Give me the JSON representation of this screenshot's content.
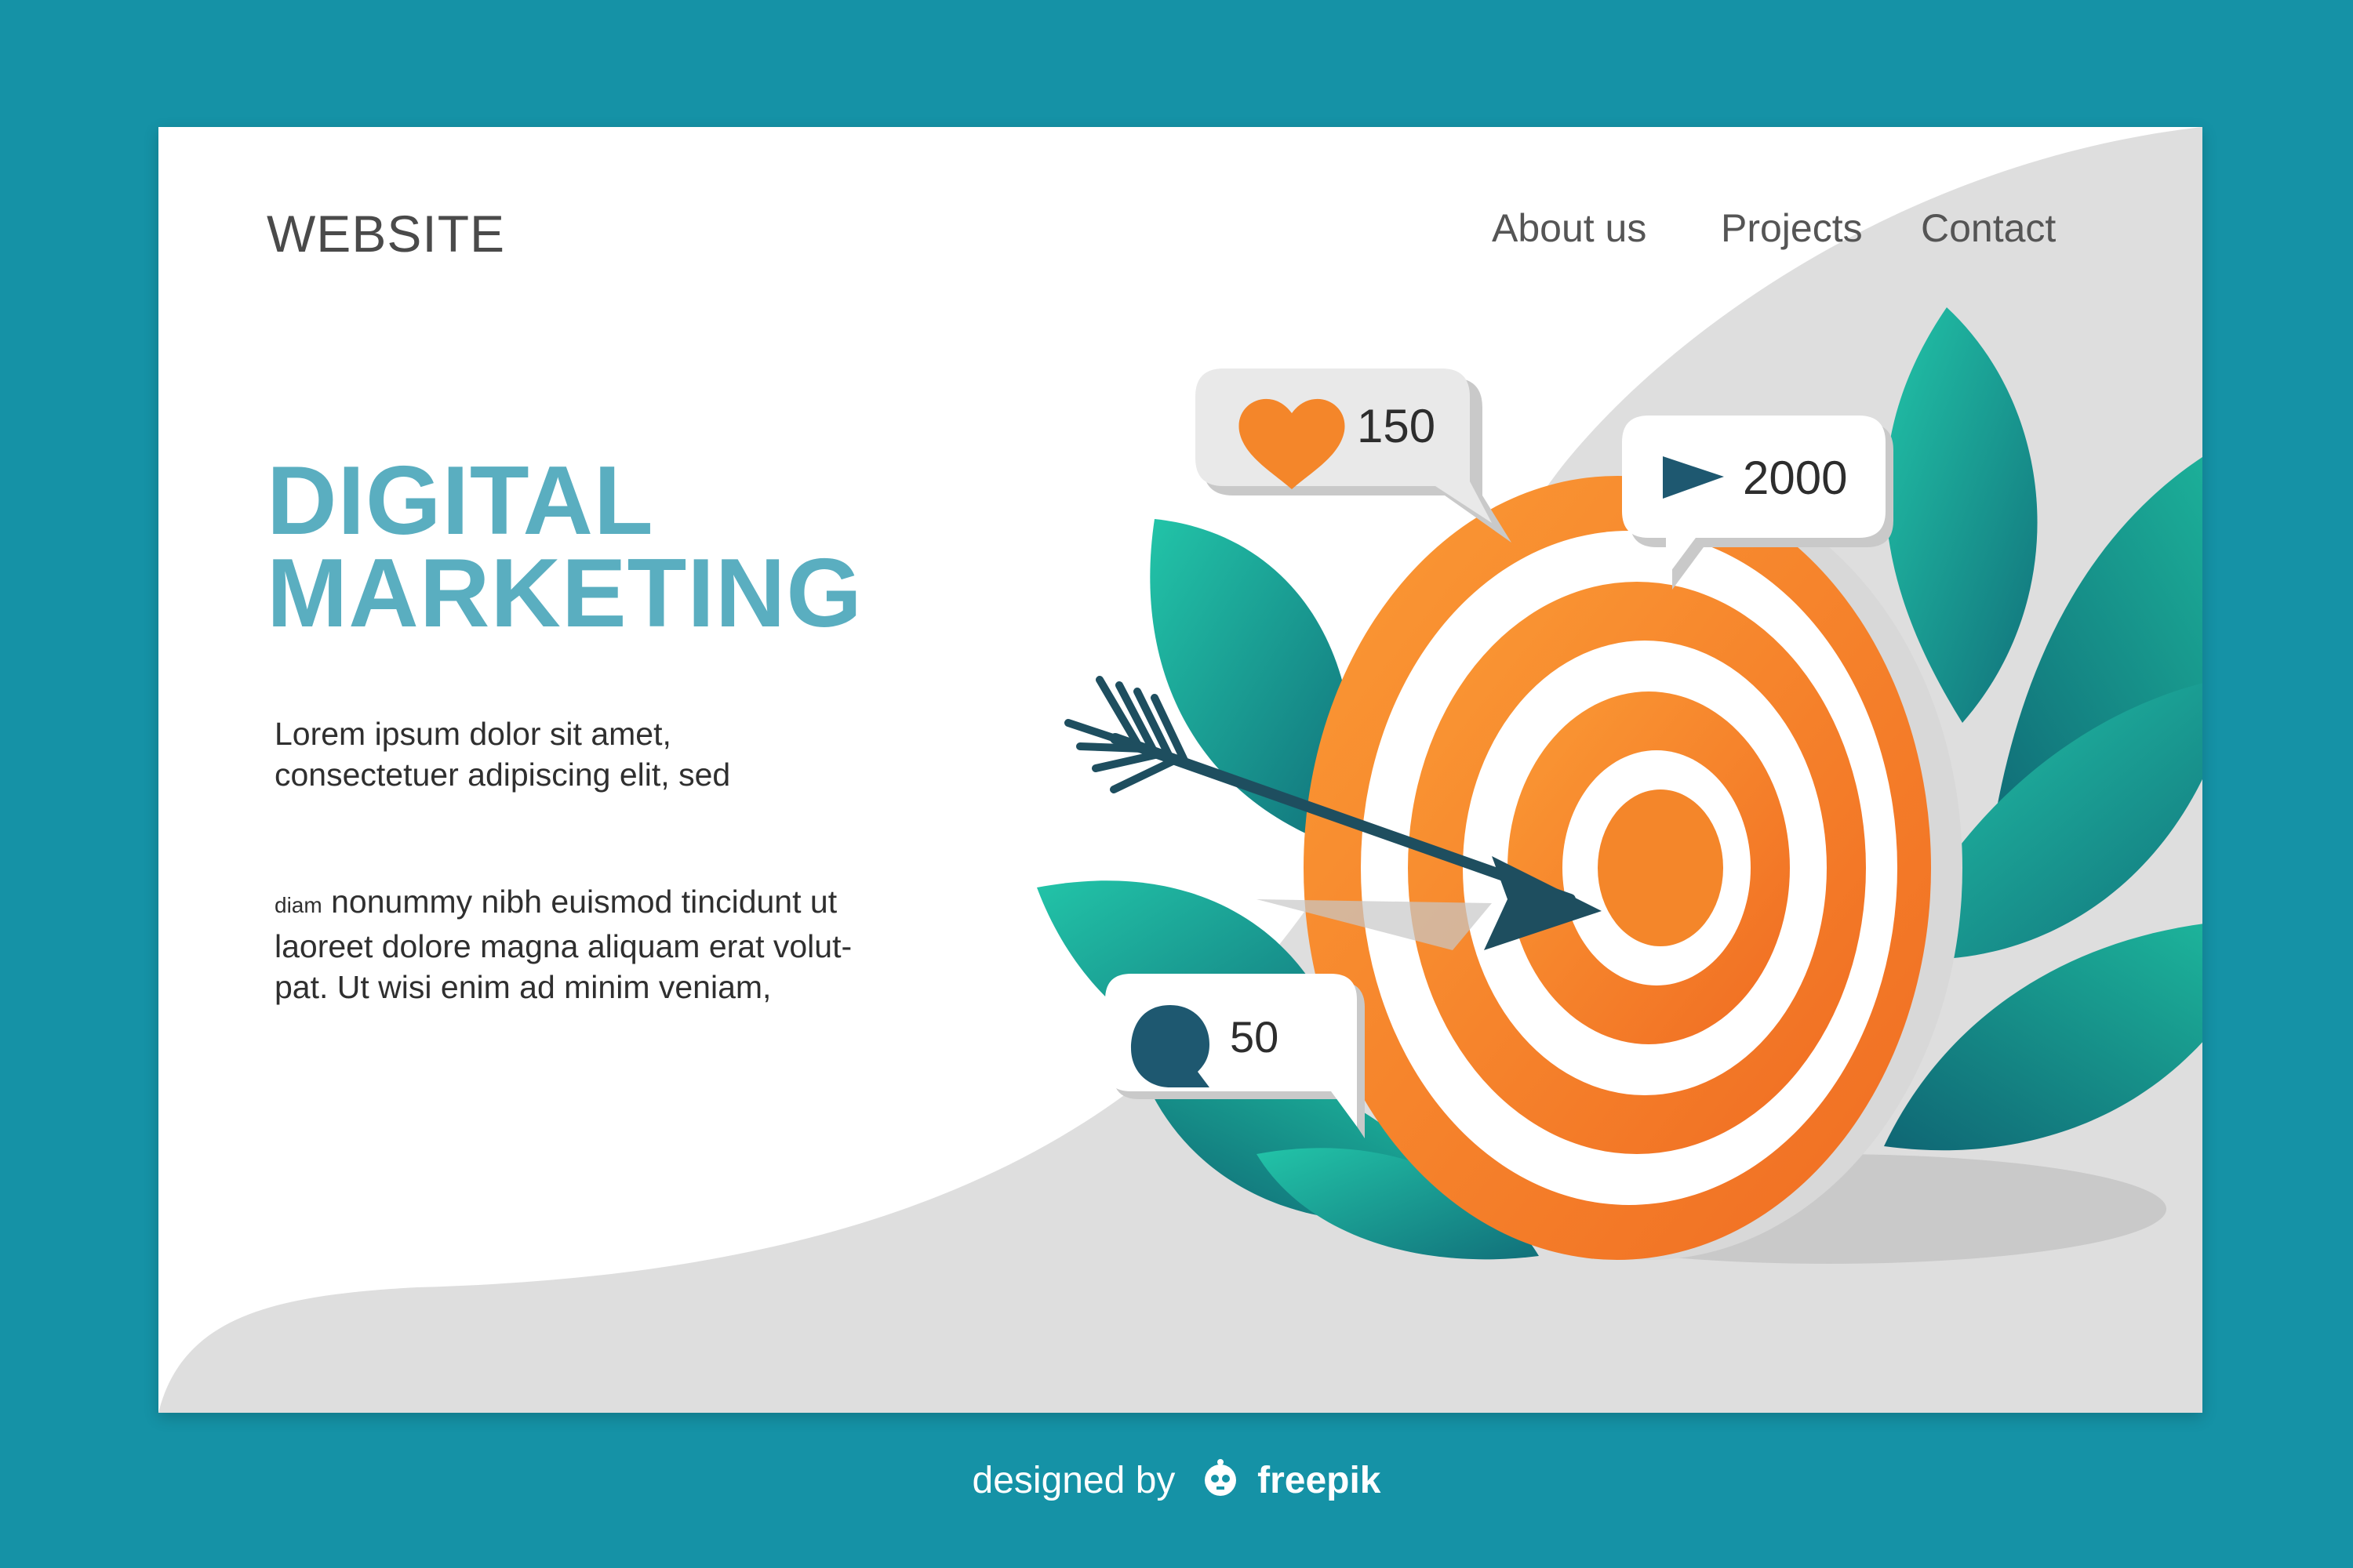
{
  "header": {
    "logo": "WEBSITE",
    "nav": [
      {
        "label": "About us"
      },
      {
        "label": "Projects"
      },
      {
        "label": "Contact"
      }
    ]
  },
  "hero": {
    "title_line1": "DIGITAL",
    "title_line2": "MARKETING",
    "para1_line1": "Lorem ipsum dolor sit amet,",
    "para1_line2": "consectetuer adipiscing elit, sed",
    "para2_small": "diam",
    "para2_line1_rest": "nonummy nibh euismod tincidunt ut",
    "para2_line2": "laoreet dolore magna aliquam erat volut-",
    "para2_line3": "pat. Ut wisi enim ad minim veniam,"
  },
  "stats": {
    "likes": {
      "icon": "heart-icon",
      "value": "150"
    },
    "views": {
      "icon": "play-icon",
      "value": "2000"
    },
    "comments": {
      "icon": "comment-icon",
      "value": "50"
    }
  },
  "footer": {
    "designed_by": "designed by",
    "brand": "freepik"
  },
  "colors": {
    "background": "#1592a6",
    "title": "#5aaec0",
    "target_orange": "#f4862a",
    "leaf_teal": "#1fb39a",
    "arrow_navy": "#1e4e5f"
  }
}
